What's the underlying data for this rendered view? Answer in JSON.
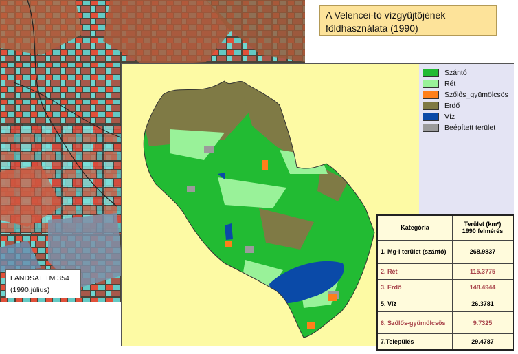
{
  "title": {
    "line1": "A Velencei-tó vízgyűjtőjének",
    "line2": "földhasználata (1990)"
  },
  "satellite_label": {
    "line1": "LANDSAT TM 354",
    "line2": "(1990.július)"
  },
  "colors": {
    "szanto": "#22bb33",
    "ret": "#99f299",
    "szolos": "#ff7f1a",
    "erdo": "#7f7a45",
    "viz": "#0a4aa8",
    "beepitett": "#9b9b9b"
  },
  "legend": [
    {
      "label": "Szántó",
      "color": "#22bb33"
    },
    {
      "label": "Rét",
      "color": "#99f299"
    },
    {
      "label": "Szőlős_gyümölcsös",
      "color": "#ff7f1a"
    },
    {
      "label": "Erdő",
      "color": "#7f7a45"
    },
    {
      "label": "Víz",
      "color": "#0a4aa8"
    },
    {
      "label": "Beépített terület",
      "color": "#9b9b9b"
    }
  ],
  "table": {
    "header_category": "Kategória",
    "header_area_line1": "Terület (km²)",
    "header_area_line2": "1990 felmérés",
    "rows": [
      {
        "category": "1. Mg-i terület (szántó)",
        "value": "268.9837"
      },
      {
        "category": "2. Rét",
        "value": "115.3775"
      },
      {
        "category": "3. Erdő",
        "value": "148.4944"
      },
      {
        "category": "5. Víz",
        "value": "26.3781"
      },
      {
        "category": "6. Szőlős-gyümölcsös",
        "value": "9.7325"
      },
      {
        "category": "7.Település",
        "value": "29.4787"
      }
    ]
  }
}
